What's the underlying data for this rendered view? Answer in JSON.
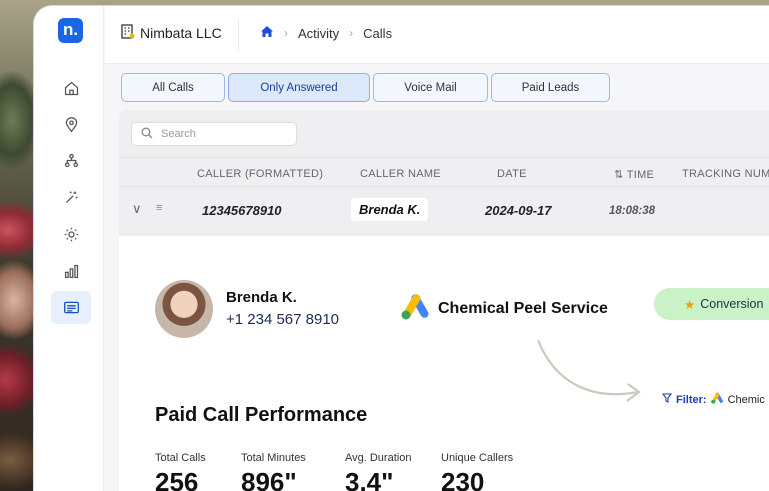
{
  "app": {
    "logo_letter": "n.",
    "company": "Nimbata LLC"
  },
  "breadcrumb": {
    "items": [
      "Activity",
      "Calls"
    ]
  },
  "tabs": [
    {
      "label": "All Calls",
      "active": false
    },
    {
      "label": "Only Answered",
      "active": true
    },
    {
      "label": "Voice Mail",
      "active": false
    },
    {
      "label": "Paid Leads",
      "active": false
    }
  ],
  "search": {
    "placeholder": "Search"
  },
  "table": {
    "columns": [
      "CALLER (FORMATTED)",
      "CALLER NAME",
      "DATE",
      "TIME",
      "TRACKING NUM"
    ],
    "row": {
      "caller": "12345678910",
      "name": "Brenda K.",
      "date": "2024-09-17",
      "time": "18:08:38"
    }
  },
  "detail": {
    "name": "Brenda K.",
    "phone": "+1 234 567 8910",
    "campaign": "Chemical Peel Service",
    "badge": "Conversion",
    "filter_label": "Filter:",
    "filter_value": "Chemic",
    "perf_title": "Paid Call Performance",
    "stats": [
      {
        "label": "Total Calls",
        "value": "256"
      },
      {
        "label": "Total Minutes",
        "value": "896\""
      },
      {
        "label": "Avg. Duration",
        "value": "3.4\""
      },
      {
        "label": "Unique Callers",
        "value": "230"
      }
    ]
  },
  "colors": {
    "accent": "#1a66e6",
    "badge_bg": "#c9f2c6",
    "tab_active_bg": "#dde8fb"
  },
  "icons": {
    "sidebar": [
      "home-icon",
      "location-pin-icon",
      "hierarchy-icon",
      "magic-wand-icon",
      "gear-icon",
      "bar-chart-icon",
      "calls-list-icon"
    ]
  }
}
